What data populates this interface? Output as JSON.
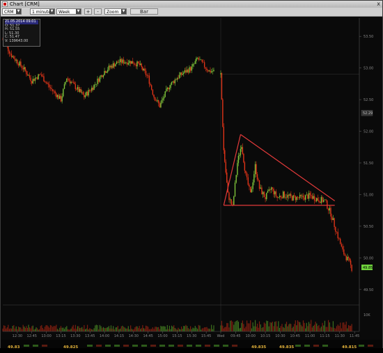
{
  "window": {
    "title": "Chart [CRM]",
    "close": "x"
  },
  "toolbar": {
    "symbol": "CRM",
    "interval": "1 minute",
    "period": "Week",
    "plus": "+",
    "minus": "-",
    "zoom": "Zoom",
    "bar": "Bar"
  },
  "info": {
    "date": "21.05.2014 09:01",
    "open": "O: 51.37",
    "high": "H: 51.55",
    "low": "L: 51.30",
    "close": "C: 51.47",
    "volume": "V: 139643.00"
  },
  "colors": {
    "up": "#7fc43a",
    "down": "#e03418",
    "pattern": "#e23a3a",
    "price_badge": "#6fd23c"
  },
  "chart_data": {
    "type": "candlestick",
    "x": [
      "12:30",
      "12:45",
      "13:00",
      "13:15",
      "13:30",
      "13:45",
      "14:00",
      "14:15",
      "14:30",
      "14:45",
      "15:00",
      "15:15",
      "15:30",
      "15:45",
      "Wed",
      "09:45",
      "10:00",
      "10:15",
      "10:30",
      "10:45",
      "11:00",
      "11:15",
      "11:30",
      "11:45"
    ],
    "y_ticks": [
      "53.50",
      "53.00",
      "52.50",
      "52.00",
      "51.50",
      "51.00",
      "50.50",
      "50.00",
      "49.50"
    ],
    "ylim": [
      49.3,
      53.7
    ],
    "price_path": [
      [
        12.25,
        53.45
      ],
      [
        12.4,
        53.2
      ],
      [
        12.6,
        53.0
      ],
      [
        12.75,
        52.8
      ],
      [
        12.9,
        52.9
      ],
      [
        13.05,
        52.7
      ],
      [
        13.25,
        52.5
      ],
      [
        13.35,
        52.85
      ],
      [
        13.5,
        52.7
      ],
      [
        13.65,
        52.55
      ],
      [
        13.8,
        52.7
      ],
      [
        14.0,
        52.95
      ],
      [
        14.15,
        53.05
      ],
      [
        14.25,
        53.1
      ],
      [
        14.45,
        53.1
      ],
      [
        14.6,
        53.05
      ],
      [
        14.75,
        52.85
      ],
      [
        14.85,
        52.55
      ],
      [
        14.95,
        52.4
      ],
      [
        15.1,
        52.7
      ],
      [
        15.25,
        52.85
      ],
      [
        15.4,
        52.95
      ],
      [
        15.5,
        53.0
      ],
      [
        15.6,
        53.15
      ],
      [
        15.7,
        53.05
      ],
      [
        15.8,
        52.95
      ],
      [
        15.9,
        52.95
      ]
    ],
    "gap_day": [
      [
        9.5,
        52.9
      ],
      [
        9.55,
        51.7
      ],
      [
        9.62,
        51.0
      ],
      [
        9.7,
        50.8
      ],
      [
        9.78,
        51.5
      ],
      [
        9.85,
        51.8
      ],
      [
        9.92,
        51.3
      ],
      [
        10.0,
        51.0
      ],
      [
        10.08,
        51.45
      ],
      [
        10.15,
        51.1
      ],
      [
        10.25,
        50.95
      ],
      [
        10.35,
        51.1
      ],
      [
        10.45,
        50.95
      ],
      [
        10.55,
        51.0
      ],
      [
        10.7,
        50.95
      ],
      [
        10.85,
        50.95
      ],
      [
        11.0,
        50.98
      ],
      [
        11.15,
        50.92
      ],
      [
        11.25,
        50.9
      ],
      [
        11.35,
        50.7
      ],
      [
        11.45,
        50.4
      ],
      [
        11.55,
        50.1
      ],
      [
        11.65,
        49.95
      ],
      [
        11.72,
        49.8
      ]
    ],
    "triangle_pattern": {
      "apex_time": "09:50",
      "apex_price": 51.95,
      "base_start_time": "09:33",
      "base_end_time": "11:25",
      "base_price": 50.83,
      "upper_end_price": 50.9
    },
    "last_price": "49.85",
    "mid_label": "52.29",
    "volume_ticks": [
      "10K"
    ],
    "bottom_labels": [
      "49.83",
      "49.825",
      "49.835",
      "49.835",
      "49.815"
    ]
  }
}
